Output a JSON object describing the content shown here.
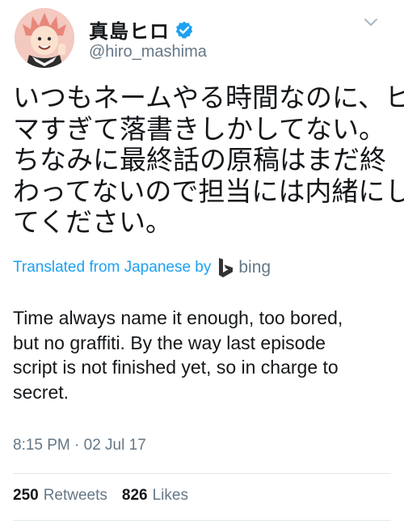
{
  "user": {
    "display_name": "真島ヒロ",
    "handle": "@hiro_mashima",
    "verified": true
  },
  "icons": {
    "verified": "verified-badge-icon",
    "menu": "chevron-down-icon",
    "translator": "bing-logo-icon"
  },
  "tweet": {
    "lines": [
      "いつもネームやる時間なのに、ヒ",
      "マすぎて落書きしかしてない。",
      "ちなみに最終話の原稿はまだ終",
      "わってないので担当には内緒にし",
      "てください。"
    ]
  },
  "translation": {
    "label": "Translated from Japanese by",
    "provider": "bing",
    "lines": [
      "Time always name it enough, too bored,",
      "but no graffiti. By the way last episode",
      "script is not finished yet, so in charge to",
      "secret."
    ]
  },
  "timestamp": "8:15 PM · 02 Jul 17",
  "stats": {
    "retweets_count": "250",
    "retweets_label": "Retweets",
    "likes_count": "826",
    "likes_label": "Likes"
  },
  "colors": {
    "link_blue": "#1da1f2",
    "muted_gray": "#657786",
    "text": "#14171a",
    "divider": "#e1e8ed"
  }
}
